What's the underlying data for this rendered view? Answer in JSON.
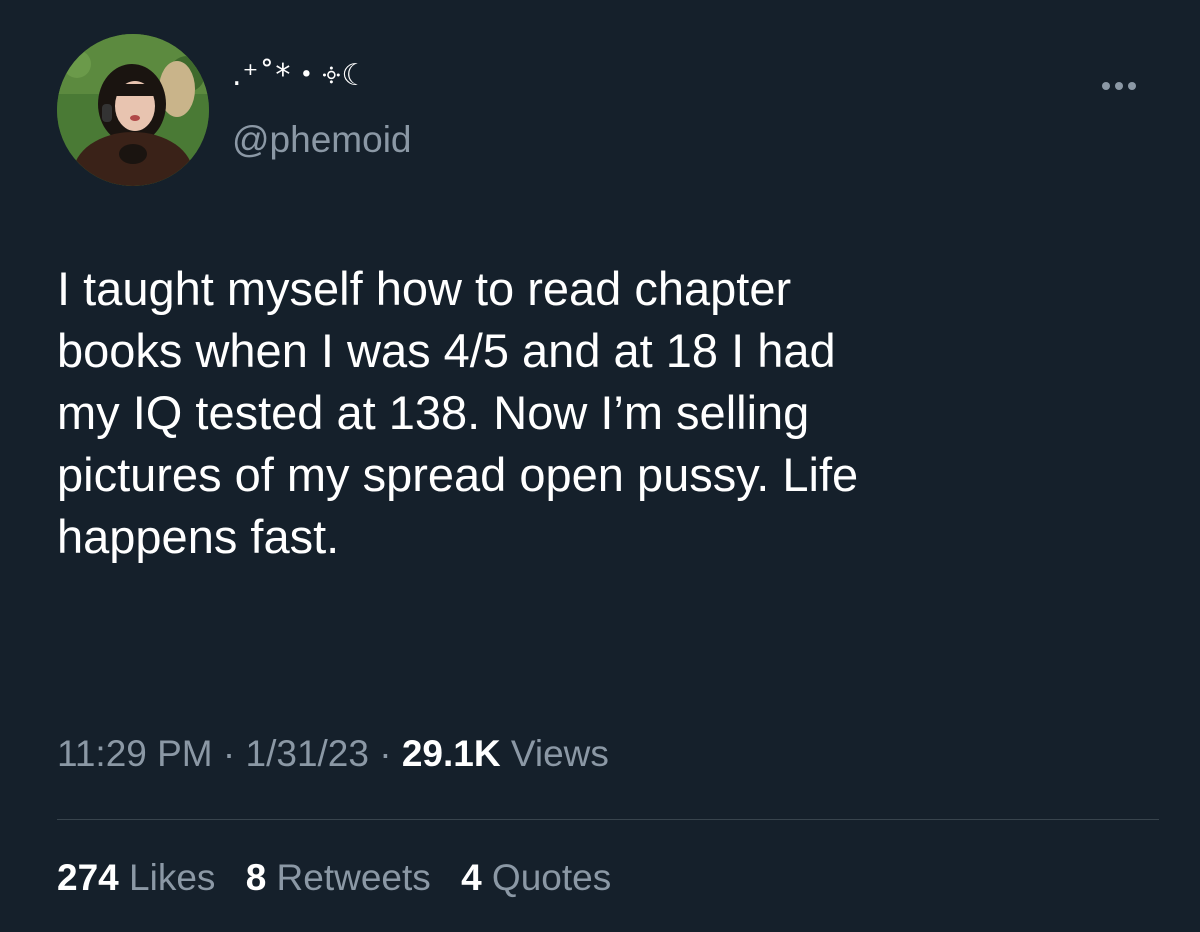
{
  "author": {
    "display_name": ".⁺˚*・༓☾",
    "handle": "@phemoid",
    "avatar_icon": "profile-photo"
  },
  "tweet": {
    "text": "I taught myself how to read chapter\nbooks when I was 4/5 and at 18 I had\nmy IQ tested at 138. Now I’m selling\npictures of my spread open pussy. Life\nhappens fast."
  },
  "meta": {
    "time": "11:29 PM",
    "separator": " · ",
    "date": "1/31/23",
    "views_count": "29.1K",
    "views_label": " Views"
  },
  "stats": {
    "likes_count": "274",
    "likes_label": "Likes",
    "retweets_count": "8",
    "retweets_label": "Retweets",
    "quotes_count": "4",
    "quotes_label": "Quotes"
  },
  "colors": {
    "background": "#15202b",
    "primary_text": "#ffffff",
    "secondary_text": "#8b98a5",
    "divider": "#38444d"
  }
}
